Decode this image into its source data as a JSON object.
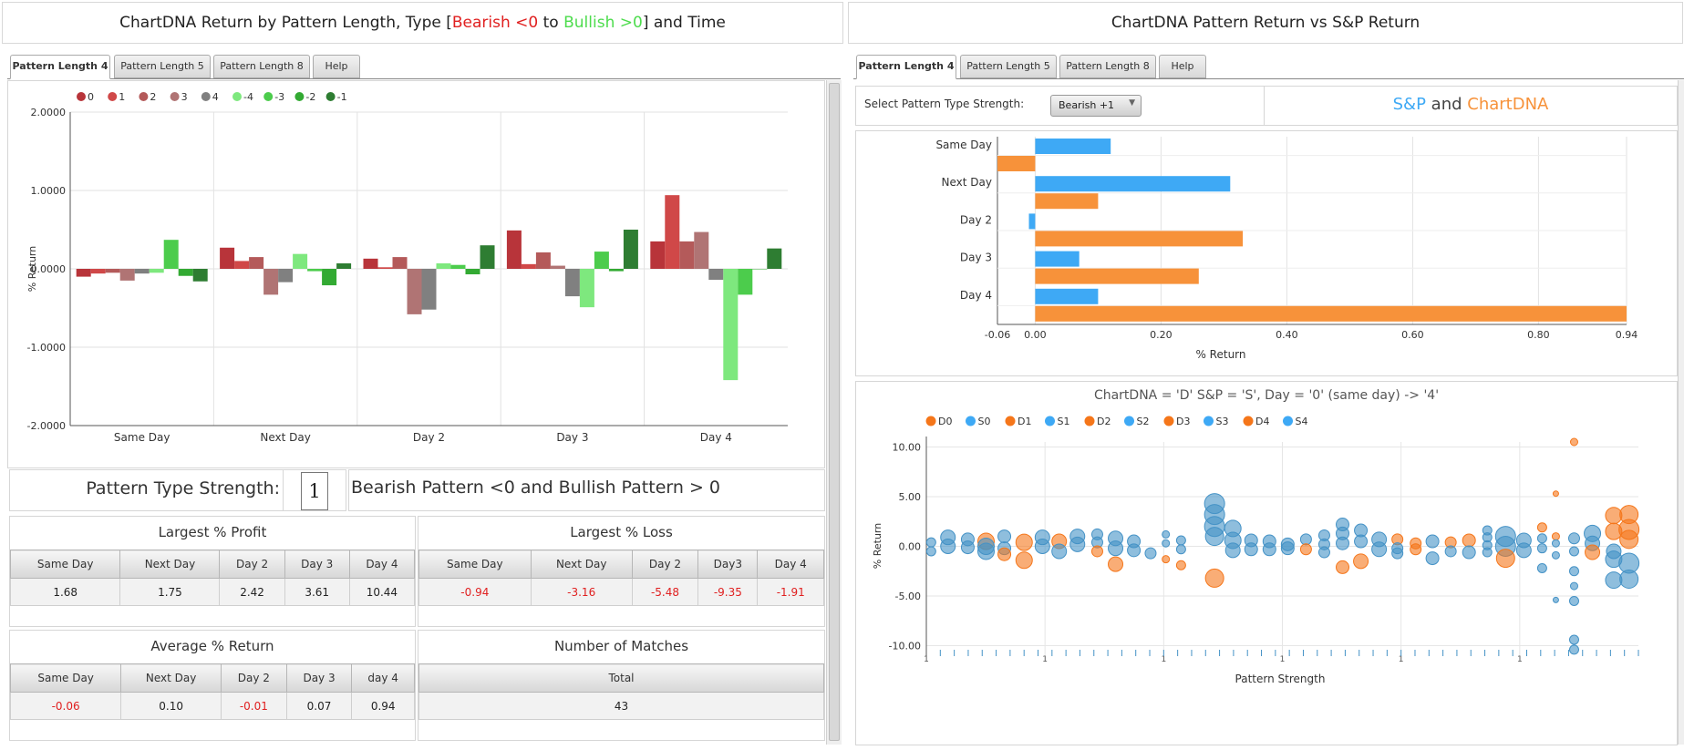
{
  "left": {
    "title_parts": [
      "ChartDNA Return by Pattern Length, Type [",
      "Bearish <0",
      " to ",
      "Bullish >0",
      "] and Time"
    ],
    "tabs": [
      "Pattern Length 4",
      "Pattern Length 5",
      "Pattern Length 8",
      "Help"
    ],
    "active_tab": 0,
    "strength_label": "Pattern Type Strength:",
    "strength_value": "1",
    "strength_desc": "Bearish Pattern <0 and Bullish Pattern > 0",
    "profit": {
      "title": "Largest % Profit",
      "headers": [
        "Same Day",
        "Next Day",
        "Day 2",
        "Day 3",
        "Day 4"
      ],
      "values": [
        "1.68",
        "1.75",
        "2.42",
        "3.61",
        "10.44"
      ]
    },
    "loss": {
      "title": "Largest % Loss",
      "headers": [
        "Same Day",
        "Next Day",
        "Day 2",
        "Day3",
        "Day 4"
      ],
      "values": [
        "-0.94",
        "-3.16",
        "-5.48",
        "-9.35",
        "-1.91"
      ]
    },
    "average": {
      "title": "Average % Return",
      "headers": [
        "Same Day",
        "Next Day",
        "Day 2",
        "Day 3",
        "day 4"
      ],
      "values": [
        "-0.06",
        "0.10",
        "-0.01",
        "0.07",
        "0.94"
      ]
    },
    "matches": {
      "title": "Number of Matches",
      "headers": [
        "Total"
      ],
      "values": [
        "43"
      ]
    }
  },
  "right": {
    "title": "ChartDNA Pattern Return vs S&P Return",
    "tabs": [
      "Pattern Length 4",
      "Pattern Length 5",
      "Pattern Length 8",
      "Help"
    ],
    "active_tab": 0,
    "select_label": "Select Pattern Type Strength:",
    "select_value": "Bearish +1",
    "legend_title": {
      "sp": "S&P",
      "and": " and ",
      "cd": "ChartDNA"
    }
  },
  "colors": {
    "sp": "#3ea9f5",
    "cd": "#f7923a",
    "neg": "#e02020",
    "pos": "#4ddc4d",
    "bubble_d": "#f5761a",
    "bubble_s": "#4492c6"
  },
  "chart_data": [
    {
      "type": "bar",
      "categories": [
        "Same Day",
        "Next Day",
        "Day 2",
        "Day 3",
        "Day 4"
      ],
      "ylabel": "% Return",
      "ylim": [
        -2,
        2
      ],
      "yticks": [
        "2.0000",
        "1.0000",
        "0.0000",
        "-1.0000",
        "-2.0000"
      ],
      "grid": true,
      "legend": "top-left",
      "series": [
        {
          "name": "0",
          "color": "#b8343a",
          "values": [
            -0.1,
            0.27,
            0.13,
            0.49,
            0.35
          ]
        },
        {
          "name": "1",
          "color": "#d04848",
          "values": [
            -0.06,
            0.1,
            0.02,
            0.06,
            0.94
          ]
        },
        {
          "name": "2",
          "color": "#b45a5a",
          "values": [
            -0.05,
            0.15,
            0.15,
            0.21,
            0.35
          ]
        },
        {
          "name": "3",
          "color": "#b07474",
          "values": [
            -0.15,
            -0.33,
            -0.58,
            0.04,
            0.47
          ]
        },
        {
          "name": "4",
          "color": "#808080",
          "values": [
            -0.06,
            -0.17,
            -0.52,
            -0.35,
            -0.14
          ]
        },
        {
          "name": "-4",
          "color": "#7ee87e",
          "values": [
            -0.05,
            0.19,
            0.07,
            -0.49,
            -1.42
          ]
        },
        {
          "name": "-3",
          "color": "#4ccc4c",
          "values": [
            0.37,
            -0.03,
            0.05,
            0.22,
            -0.33
          ]
        },
        {
          "name": "-2",
          "color": "#33aa33",
          "values": [
            -0.09,
            -0.21,
            -0.07,
            -0.03,
            0.0
          ]
        },
        {
          "name": "-1",
          "color": "#2e7d32",
          "values": [
            -0.16,
            0.07,
            0.3,
            0.5,
            0.26
          ]
        }
      ]
    },
    {
      "type": "bar",
      "orientation": "horizontal",
      "categories": [
        "Same Day",
        "Next Day",
        "Day 2",
        "Day 3",
        "Day 4"
      ],
      "xlabel": "% Return",
      "xlim": [
        -0.06,
        0.94
      ],
      "xticks": [
        "-0.06",
        "0.00",
        "0.20",
        "0.40",
        "0.60",
        "0.80",
        "0.94"
      ],
      "grid": true,
      "series": [
        {
          "name": "S&P",
          "color": "#3ea9f5",
          "values": [
            0.12,
            0.31,
            -0.01,
            0.07,
            0.1
          ]
        },
        {
          "name": "ChartDNA",
          "color": "#f7923a",
          "values": [
            -0.06,
            0.1,
            0.33,
            0.26,
            0.94
          ]
        }
      ]
    },
    {
      "type": "scatter",
      "title": "ChartDNA = 'D' S&P = 'S', Day = '0' (same day) -> '4'",
      "xlabel": "Pattern Strength",
      "ylabel": "% Return",
      "ylim": [
        -10.5,
        10.5
      ],
      "yticks": [
        "10.00",
        "5.00",
        "0.00",
        "-5.00",
        "-10.00"
      ],
      "xticks": [
        "1",
        "1",
        "1",
        "1",
        "1",
        "1"
      ],
      "legend": [
        "D0",
        "S0",
        "D1",
        "S1",
        "D2",
        "S2",
        "D3",
        "S3",
        "D4",
        "S4"
      ],
      "points": [
        {
          "x": 0.2,
          "y": 0.4,
          "r": 5,
          "s": "S"
        },
        {
          "x": 0.2,
          "y": -0.5,
          "r": 5,
          "s": "S"
        },
        {
          "x": 1.3,
          "y": 0.9,
          "r": 8,
          "s": "S"
        },
        {
          "x": 1.3,
          "y": 0.0,
          "r": 8,
          "s": "S"
        },
        {
          "x": 2.6,
          "y": 0.7,
          "r": 7,
          "s": "S"
        },
        {
          "x": 2.6,
          "y": -0.1,
          "r": 7,
          "s": "S"
        },
        {
          "x": 3.8,
          "y": 0.5,
          "r": 9,
          "s": "D"
        },
        {
          "x": 3.8,
          "y": -0.5,
          "r": 9,
          "s": "S"
        },
        {
          "x": 3.8,
          "y": 0.0,
          "r": 9,
          "s": "S"
        },
        {
          "x": 5.0,
          "y": 1.0,
          "r": 7,
          "s": "S"
        },
        {
          "x": 5.0,
          "y": -0.2,
          "r": 7,
          "s": "S"
        },
        {
          "x": 5.0,
          "y": -0.8,
          "r": 7,
          "s": "D"
        },
        {
          "x": 6.3,
          "y": 0.4,
          "r": 9,
          "s": "D"
        },
        {
          "x": 6.3,
          "y": -1.4,
          "r": 9,
          "s": "D"
        },
        {
          "x": 7.5,
          "y": 0.9,
          "r": 8,
          "s": "S"
        },
        {
          "x": 7.5,
          "y": 0.0,
          "r": 8,
          "s": "S"
        },
        {
          "x": 8.6,
          "y": 0.5,
          "r": 8,
          "s": "D"
        },
        {
          "x": 8.6,
          "y": -0.5,
          "r": 8,
          "s": "S"
        },
        {
          "x": 9.8,
          "y": 1.0,
          "r": 8,
          "s": "S"
        },
        {
          "x": 9.8,
          "y": 0.2,
          "r": 8,
          "s": "S"
        },
        {
          "x": 11.1,
          "y": 1.2,
          "r": 6,
          "s": "S"
        },
        {
          "x": 11.1,
          "y": 0.4,
          "r": 6,
          "s": "S"
        },
        {
          "x": 11.1,
          "y": -0.5,
          "r": 6,
          "s": "D"
        },
        {
          "x": 12.3,
          "y": 0.8,
          "r": 8,
          "s": "S"
        },
        {
          "x": 12.3,
          "y": -0.2,
          "r": 8,
          "s": "S"
        },
        {
          "x": 12.3,
          "y": -1.8,
          "r": 8,
          "s": "D"
        },
        {
          "x": 13.5,
          "y": 0.5,
          "r": 7,
          "s": "S"
        },
        {
          "x": 13.5,
          "y": -0.4,
          "r": 7,
          "s": "S"
        },
        {
          "x": 14.6,
          "y": -0.7,
          "r": 6,
          "s": "S"
        },
        {
          "x": 15.6,
          "y": 1.2,
          "r": 4,
          "s": "S"
        },
        {
          "x": 15.6,
          "y": 0.3,
          "r": 4,
          "s": "S"
        },
        {
          "x": 15.6,
          "y": -1.3,
          "r": 4,
          "s": "D"
        },
        {
          "x": 16.6,
          "y": 0.6,
          "r": 5,
          "s": "S"
        },
        {
          "x": 16.6,
          "y": -0.3,
          "r": 5,
          "s": "S"
        },
        {
          "x": 16.6,
          "y": -1.9,
          "r": 5,
          "s": "D"
        },
        {
          "x": 18.8,
          "y": 4.3,
          "r": 11,
          "s": "S"
        },
        {
          "x": 18.8,
          "y": 3.2,
          "r": 11,
          "s": "S"
        },
        {
          "x": 18.8,
          "y": 2.0,
          "r": 11,
          "s": "S"
        },
        {
          "x": 18.8,
          "y": 1.0,
          "r": 10,
          "s": "S"
        },
        {
          "x": 18.8,
          "y": -3.2,
          "r": 10,
          "s": "D"
        },
        {
          "x": 20.0,
          "y": 1.8,
          "r": 9,
          "s": "S"
        },
        {
          "x": 20.0,
          "y": 0.6,
          "r": 9,
          "s": "S"
        },
        {
          "x": 20.0,
          "y": -0.4,
          "r": 8,
          "s": "S"
        },
        {
          "x": 21.2,
          "y": 0.6,
          "r": 7,
          "s": "S"
        },
        {
          "x": 21.2,
          "y": -0.3,
          "r": 7,
          "s": "S"
        },
        {
          "x": 22.4,
          "y": 0.5,
          "r": 7,
          "s": "S"
        },
        {
          "x": 22.4,
          "y": -0.3,
          "r": 7,
          "s": "S"
        },
        {
          "x": 23.6,
          "y": 0.2,
          "r": 7,
          "s": "S"
        },
        {
          "x": 23.6,
          "y": -0.2,
          "r": 7,
          "s": "S"
        },
        {
          "x": 24.8,
          "y": 0.7,
          "r": 6,
          "s": "S"
        },
        {
          "x": 24.8,
          "y": -0.3,
          "r": 6,
          "s": "D"
        },
        {
          "x": 26.0,
          "y": 1.1,
          "r": 6,
          "s": "S"
        },
        {
          "x": 26.0,
          "y": 0.2,
          "r": 6,
          "s": "S"
        },
        {
          "x": 26.0,
          "y": -0.6,
          "r": 6,
          "s": "S"
        },
        {
          "x": 27.2,
          "y": 2.2,
          "r": 7,
          "s": "S"
        },
        {
          "x": 27.2,
          "y": 1.3,
          "r": 7,
          "s": "S"
        },
        {
          "x": 27.2,
          "y": 0.3,
          "r": 7,
          "s": "S"
        },
        {
          "x": 27.2,
          "y": -2.1,
          "r": 7,
          "s": "D"
        },
        {
          "x": 28.4,
          "y": 1.6,
          "r": 7,
          "s": "S"
        },
        {
          "x": 28.4,
          "y": 0.5,
          "r": 7,
          "s": "S"
        },
        {
          "x": 28.4,
          "y": -1.5,
          "r": 8,
          "s": "D"
        },
        {
          "x": 29.6,
          "y": 0.7,
          "r": 8,
          "s": "S"
        },
        {
          "x": 29.6,
          "y": -0.3,
          "r": 8,
          "s": "S"
        },
        {
          "x": 30.8,
          "y": 0.7,
          "r": 6,
          "s": "D"
        },
        {
          "x": 30.8,
          "y": -0.2,
          "r": 6,
          "s": "S"
        },
        {
          "x": 30.8,
          "y": -0.7,
          "r": 6,
          "s": "S"
        },
        {
          "x": 32.0,
          "y": 0.3,
          "r": 6,
          "s": "D"
        },
        {
          "x": 32.0,
          "y": -0.3,
          "r": 6,
          "s": "D"
        },
        {
          "x": 33.1,
          "y": 0.5,
          "r": 7,
          "s": "S"
        },
        {
          "x": 33.1,
          "y": -1.2,
          "r": 7,
          "s": "S"
        },
        {
          "x": 34.3,
          "y": 0.4,
          "r": 6,
          "s": "D"
        },
        {
          "x": 34.3,
          "y": -0.5,
          "r": 6,
          "s": "S"
        },
        {
          "x": 35.5,
          "y": 0.6,
          "r": 7,
          "s": "D"
        },
        {
          "x": 35.5,
          "y": -0.6,
          "r": 7,
          "s": "S"
        },
        {
          "x": 36.7,
          "y": 1.6,
          "r": 5,
          "s": "S"
        },
        {
          "x": 36.7,
          "y": 0.9,
          "r": 5,
          "s": "S"
        },
        {
          "x": 36.7,
          "y": 0.1,
          "r": 5,
          "s": "S"
        },
        {
          "x": 36.7,
          "y": -0.6,
          "r": 5,
          "s": "S"
        },
        {
          "x": 37.9,
          "y": 1.0,
          "r": 11,
          "s": "S"
        },
        {
          "x": 37.9,
          "y": 0.0,
          "r": 11,
          "s": "S"
        },
        {
          "x": 37.9,
          "y": -1.2,
          "r": 10,
          "s": "D"
        },
        {
          "x": 39.1,
          "y": 0.6,
          "r": 8,
          "s": "S"
        },
        {
          "x": 39.1,
          "y": -0.4,
          "r": 8,
          "s": "S"
        },
        {
          "x": 40.3,
          "y": 1.9,
          "r": 5,
          "s": "D"
        },
        {
          "x": 40.3,
          "y": 0.8,
          "r": 5,
          "s": "S"
        },
        {
          "x": 40.3,
          "y": -0.2,
          "r": 5,
          "s": "S"
        },
        {
          "x": 40.3,
          "y": -2.2,
          "r": 5,
          "s": "S"
        },
        {
          "x": 41.2,
          "y": 5.3,
          "r": 3,
          "s": "D"
        },
        {
          "x": 41.2,
          "y": 1.0,
          "r": 4,
          "s": "D"
        },
        {
          "x": 41.2,
          "y": 0.3,
          "r": 4,
          "s": "S"
        },
        {
          "x": 41.2,
          "y": -0.9,
          "r": 4,
          "s": "S"
        },
        {
          "x": 41.2,
          "y": -5.4,
          "r": 3,
          "s": "S"
        },
        {
          "x": 42.4,
          "y": 10.5,
          "r": 4,
          "s": "D"
        },
        {
          "x": 42.4,
          "y": 0.8,
          "r": 6,
          "s": "S"
        },
        {
          "x": 42.4,
          "y": -0.5,
          "r": 5,
          "s": "S"
        },
        {
          "x": 42.4,
          "y": -2.5,
          "r": 5,
          "s": "S"
        },
        {
          "x": 42.4,
          "y": -4.0,
          "r": 4,
          "s": "S"
        },
        {
          "x": 42.4,
          "y": -5.5,
          "r": 5,
          "s": "S"
        },
        {
          "x": 42.4,
          "y": -9.4,
          "r": 5,
          "s": "S"
        },
        {
          "x": 42.4,
          "y": -10.4,
          "r": 5,
          "s": "S"
        },
        {
          "x": 43.6,
          "y": 1.3,
          "r": 9,
          "s": "S"
        },
        {
          "x": 43.6,
          "y": 0.3,
          "r": 8,
          "s": "S"
        },
        {
          "x": 43.6,
          "y": -0.6,
          "r": 8,
          "s": "D"
        },
        {
          "x": 45.0,
          "y": 3.1,
          "r": 9,
          "s": "D"
        },
        {
          "x": 45.0,
          "y": 1.5,
          "r": 9,
          "s": "D"
        },
        {
          "x": 45.0,
          "y": -0.5,
          "r": 8,
          "s": "S"
        },
        {
          "x": 45.0,
          "y": -1.3,
          "r": 9,
          "s": "S"
        },
        {
          "x": 45.0,
          "y": -3.4,
          "r": 9,
          "s": "S"
        },
        {
          "x": 46.0,
          "y": 3.2,
          "r": 10,
          "s": "D"
        },
        {
          "x": 46.0,
          "y": 1.7,
          "r": 11,
          "s": "D"
        },
        {
          "x": 46.0,
          "y": 0.7,
          "r": 10,
          "s": "D"
        },
        {
          "x": 46.0,
          "y": -1.7,
          "r": 11,
          "s": "S"
        },
        {
          "x": 46.0,
          "y": -3.3,
          "r": 10,
          "s": "S"
        }
      ]
    }
  ]
}
